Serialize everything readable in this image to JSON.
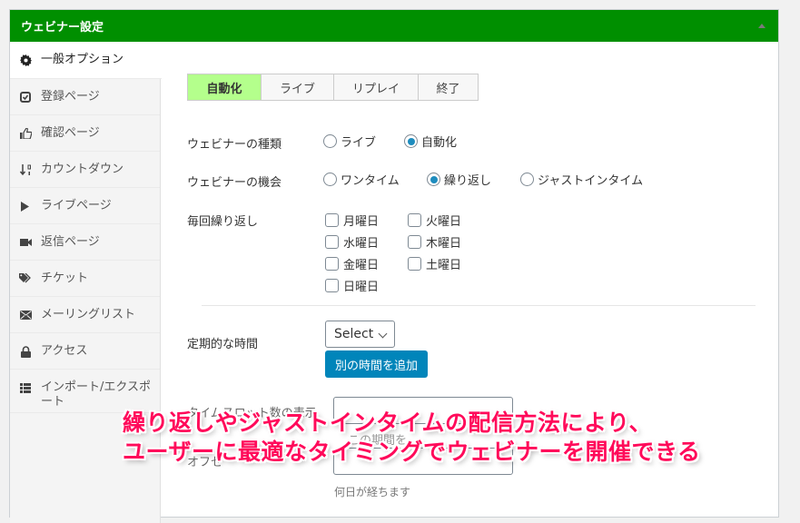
{
  "panel": {
    "title": "ウェビナー設定",
    "colors": {
      "header_bg": "#008f00",
      "active_tab_bg": "#b4ff8c",
      "primary_button": "#0085ba",
      "radio_checked": "#1e8cbe",
      "overlay_text": "#ff0a5a"
    }
  },
  "sidebar": {
    "items": [
      {
        "label": "一般オプション",
        "icon": "gear-icon",
        "active": true
      },
      {
        "label": "登録ページ",
        "icon": "check-square-icon"
      },
      {
        "label": "確認ページ",
        "icon": "thumbs-up-icon"
      },
      {
        "label": "カウントダウン",
        "icon": "sort-numeric-icon"
      },
      {
        "label": "ライブページ",
        "icon": "play-icon"
      },
      {
        "label": "返信ページ",
        "icon": "video-camera-icon"
      },
      {
        "label": "チケット",
        "icon": "tags-icon"
      },
      {
        "label": "メーリングリスト",
        "icon": "envelope-icon"
      },
      {
        "label": "アクセス",
        "icon": "lock-icon"
      },
      {
        "label": "インポート/エクスポート",
        "icon": "list-icon"
      }
    ]
  },
  "tabs": [
    {
      "label": "自動化",
      "active": true
    },
    {
      "label": "ライブ"
    },
    {
      "label": "リプレイ"
    },
    {
      "label": "終了"
    }
  ],
  "form": {
    "webinar_type": {
      "label": "ウェビナーの種類",
      "options": [
        {
          "label": "ライブ",
          "checked": false
        },
        {
          "label": "自動化",
          "checked": true
        }
      ]
    },
    "webinar_occasion": {
      "label": "ウェビナーの機会",
      "options": [
        {
          "label": "ワンタイム",
          "checked": false
        },
        {
          "label": "繰り返し",
          "checked": true
        },
        {
          "label": "ジャストインタイム",
          "checked": false
        }
      ]
    },
    "repeat_every": {
      "label": "毎回繰り返し",
      "days": [
        {
          "label": "月曜日",
          "checked": false
        },
        {
          "label": "火曜日",
          "checked": false
        },
        {
          "label": "水曜日",
          "checked": false
        },
        {
          "label": "木曜日",
          "checked": false
        },
        {
          "label": "金曜日",
          "checked": false
        },
        {
          "label": "土曜日",
          "checked": false
        },
        {
          "label": "日曜日",
          "checked": false
        }
      ]
    },
    "regular_time": {
      "label": "定期的な時間",
      "select_value": "Select",
      "add_button": "別の時間を追加"
    },
    "timeslot_display": {
      "label": "タイムスロット数の表示",
      "partial_text": "この期間を",
      "partial_label2": "オフセ"
    },
    "days_hint": "何日が経ちます"
  },
  "overlay": {
    "line1": "繰り返しやジャストインタイムの配信方法により、",
    "line2": "ユーザーに最適なタイミングでウェビナーを開催できる"
  }
}
